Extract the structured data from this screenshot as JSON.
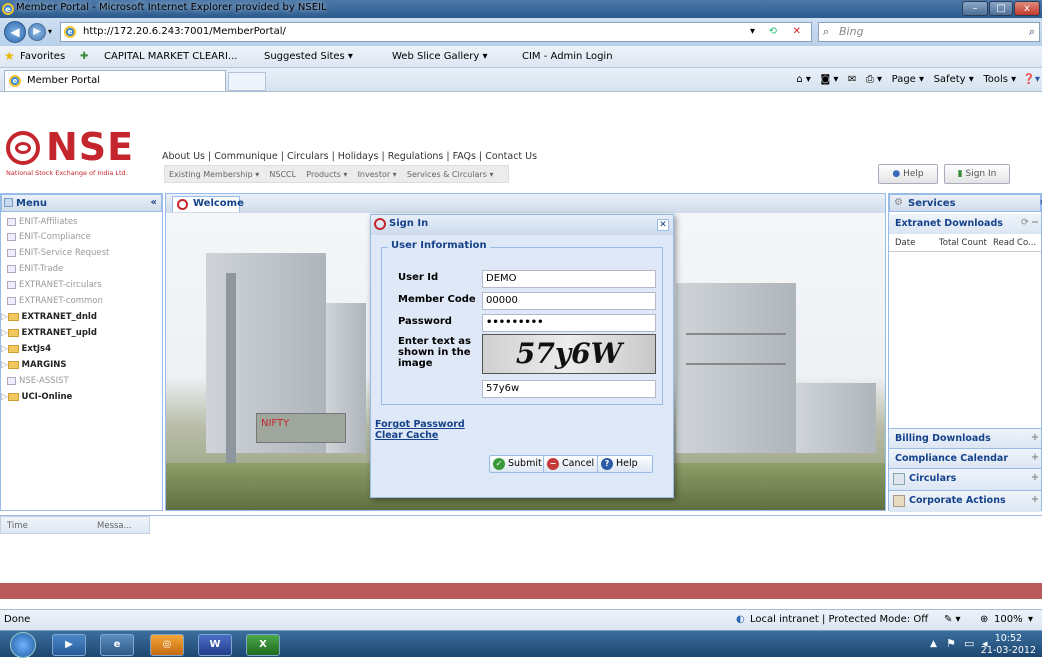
{
  "window": {
    "title": "Member Portal - Microsoft Internet Explorer provided by NSEIL",
    "min": "–",
    "max": "□",
    "close": "x"
  },
  "address": {
    "url": "http://172.20.6.243:7001/MemberPortal/",
    "search_placeholder": "Bing"
  },
  "favorites": {
    "label": "Favorites",
    "items": [
      "CAPITAL MARKET CLEARI...",
      "Suggested Sites ▾",
      "Web Slice Gallery ▾",
      "CIM - Admin Login"
    ]
  },
  "tab": {
    "label": "Member Portal"
  },
  "commandbar": {
    "page": "Page ▾",
    "safety": "Safety ▾",
    "tools": "Tools ▾"
  },
  "header": {
    "logo": "NSE",
    "logo_sub": "National Stock Exchange of India Ltd.",
    "links": "About Us | Communique | Circulars | Holidays | Regulations | FAQs | Contact Us",
    "menu": [
      "Existing Membership ▾",
      "NSCCL",
      "Products ▾",
      "Investor ▾",
      "Services & Circulars ▾"
    ],
    "help": "Help",
    "signin": "Sign In"
  },
  "left": {
    "title": "Menu",
    "items": [
      {
        "label": "ENIT-Affiliates",
        "type": "leaf"
      },
      {
        "label": "ENIT-Compliance",
        "type": "leaf"
      },
      {
        "label": "ENIT-Service Request",
        "type": "leaf"
      },
      {
        "label": "ENIT-Trade",
        "type": "leaf"
      },
      {
        "label": "EXTRANET-circulars",
        "type": "leaf"
      },
      {
        "label": "EXTRANET-common",
        "type": "leaf"
      },
      {
        "label": "EXTRANET_dnld",
        "type": "folder"
      },
      {
        "label": "EXTRANET_upld",
        "type": "folder"
      },
      {
        "label": "ExtJs4",
        "type": "folder"
      },
      {
        "label": "MARGINS",
        "type": "folder"
      },
      {
        "label": "NSE-ASSIST",
        "type": "leaf"
      },
      {
        "label": "UCI-Online",
        "type": "folder"
      }
    ]
  },
  "center": {
    "tab": "Welcome"
  },
  "right": {
    "title": "Services",
    "extranet": "Extranet Downloads",
    "cols": [
      "Date",
      "Total Count",
      "Read Co..."
    ],
    "billing": "Billing Downloads",
    "compliance": "Compliance Calendar",
    "circulars": "Circulars",
    "corporate": "Corporate Actions"
  },
  "dialog": {
    "title": "Sign In",
    "legend": "User Information",
    "user_label": "User Id",
    "user_value": "DEMO",
    "member_label": "Member Code",
    "member_value": "00000",
    "password_label": "Password",
    "password_value": "•••••••••",
    "captcha_label": "Enter text as shown in the image",
    "captcha_image_text": "57y6W",
    "captcha_value": "57y6w",
    "forgot": "Forgot Password",
    "clear": "Clear Cache",
    "submit": "Submit",
    "cancel": "Cancel",
    "help": "Help"
  },
  "messages": {
    "col1": "Time",
    "col2": "Messa..."
  },
  "status": {
    "left": "Done",
    "zone": "Local intranet | Protected Mode: Off",
    "zoom": "100%"
  },
  "taskbar": {
    "time": "10:52",
    "date": "21-03-2012"
  }
}
